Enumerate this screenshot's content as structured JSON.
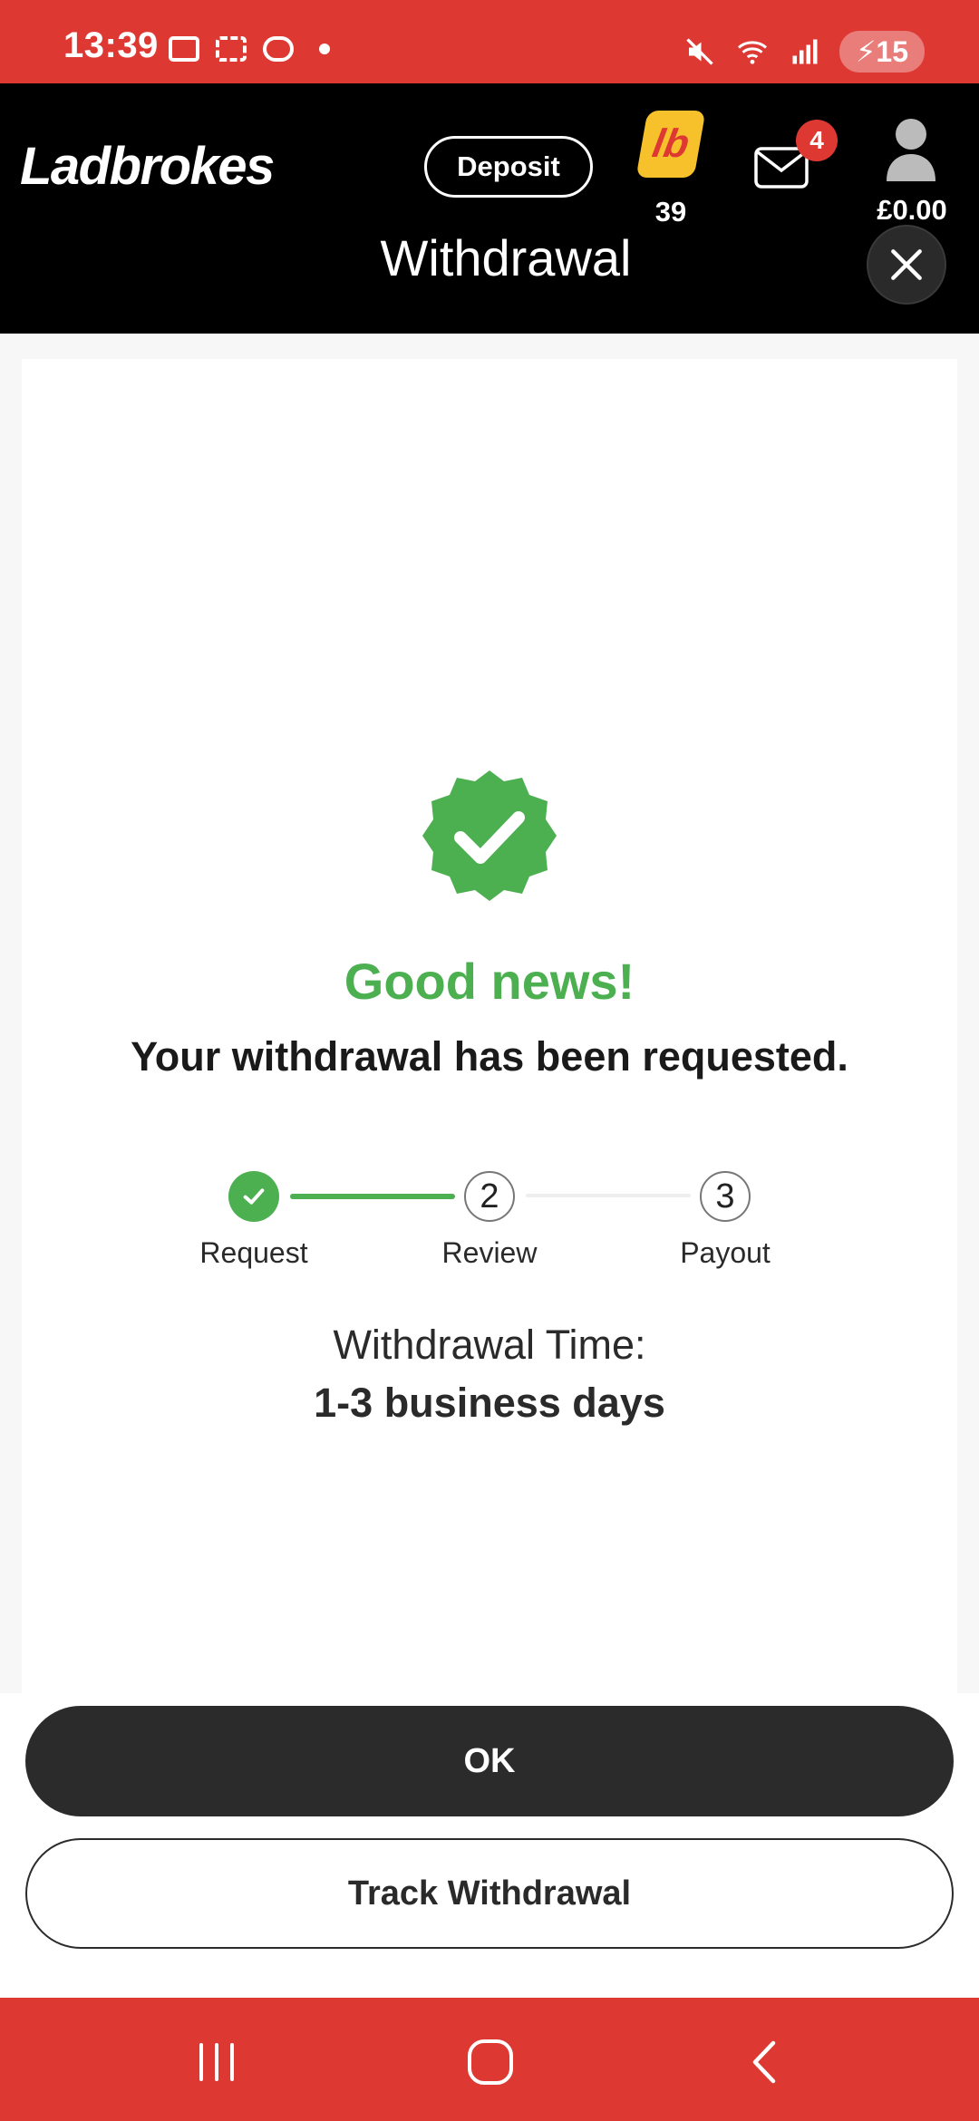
{
  "status_bar": {
    "time": "13:39",
    "battery": "15",
    "icons": [
      "sd-card-icon",
      "screenshot-icon",
      "app-notification-icon",
      "mute-icon",
      "wifi-icon",
      "signal-icon",
      "battery-icon"
    ]
  },
  "header": {
    "logo": "Ladbrokes",
    "deposit_label": "Deposit",
    "loyalty_badge": "lb",
    "loyalty_count": "39",
    "messages_count": "4",
    "balance": "£0.00",
    "title": "Withdrawal"
  },
  "content": {
    "headline": "Good news!",
    "message": "Your withdrawal has been requested.",
    "steps": [
      {
        "number": "",
        "label": "Request",
        "state": "complete"
      },
      {
        "number": "2",
        "label": "Review",
        "state": "pending"
      },
      {
        "number": "3",
        "label": "Payout",
        "state": "pending"
      }
    ],
    "withdrawal_time_label": "Withdrawal Time:",
    "withdrawal_time_value": "1-3 business days"
  },
  "actions": {
    "ok_label": "OK",
    "track_label": "Track Withdrawal"
  },
  "colors": {
    "brand_red": "#de3833",
    "success_green": "#4caf50",
    "header_black": "#000000",
    "button_dark": "#2b2b2b"
  }
}
